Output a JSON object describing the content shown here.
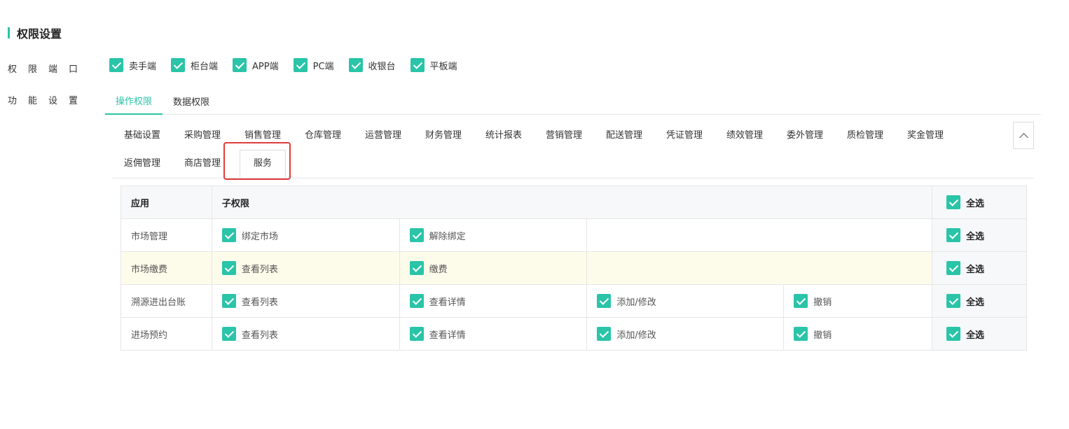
{
  "section": {
    "title": "权限设置"
  },
  "labels": {
    "platform_row": [
      "权",
      "限",
      "端",
      "口"
    ],
    "feature_row": [
      "功",
      "能",
      "设",
      "置"
    ]
  },
  "platforms": [
    {
      "label": "卖手端",
      "checked": true
    },
    {
      "label": "柜台端",
      "checked": true
    },
    {
      "label": "APP端",
      "checked": true
    },
    {
      "label": "PC端",
      "checked": true
    },
    {
      "label": "收银台",
      "checked": true
    },
    {
      "label": "平板端",
      "checked": true
    }
  ],
  "tabs": [
    {
      "label": "操作权限",
      "active": true
    },
    {
      "label": "数据权限",
      "active": false
    }
  ],
  "modules": {
    "row1": [
      "基础设置",
      "采购管理",
      "销售管理",
      "仓库管理",
      "运营管理",
      "财务管理",
      "统计报表",
      "营销管理",
      "配送管理",
      "凭证管理",
      "绩效管理",
      "委外管理",
      "质检管理",
      "奖金管理"
    ],
    "row2": [
      "返佣管理",
      "商店管理"
    ],
    "selected": "服务"
  },
  "table": {
    "headers": {
      "app": "应用",
      "sub": "子权限",
      "select_all": "全选"
    },
    "rows": [
      {
        "app": "市场管理",
        "perms": [
          "绑定市场",
          "解除绑定"
        ],
        "select_all": "全选"
      },
      {
        "app": "市场缴费",
        "perms": [
          "查看列表",
          "缴费"
        ],
        "select_all": "全选"
      },
      {
        "app": "溯源进出台账",
        "perms": [
          "查看列表",
          "查看详情",
          "添加/修改",
          "撤销"
        ],
        "select_all": "全选"
      },
      {
        "app": "进场预约",
        "perms": [
          "查看列表",
          "查看详情",
          "添加/修改",
          "撤销"
        ],
        "select_all": "全选"
      }
    ]
  },
  "colors": {
    "accent": "#2ac4a8",
    "highlight_border": "#e23b3b",
    "row_highlight": "#fdfbea"
  }
}
